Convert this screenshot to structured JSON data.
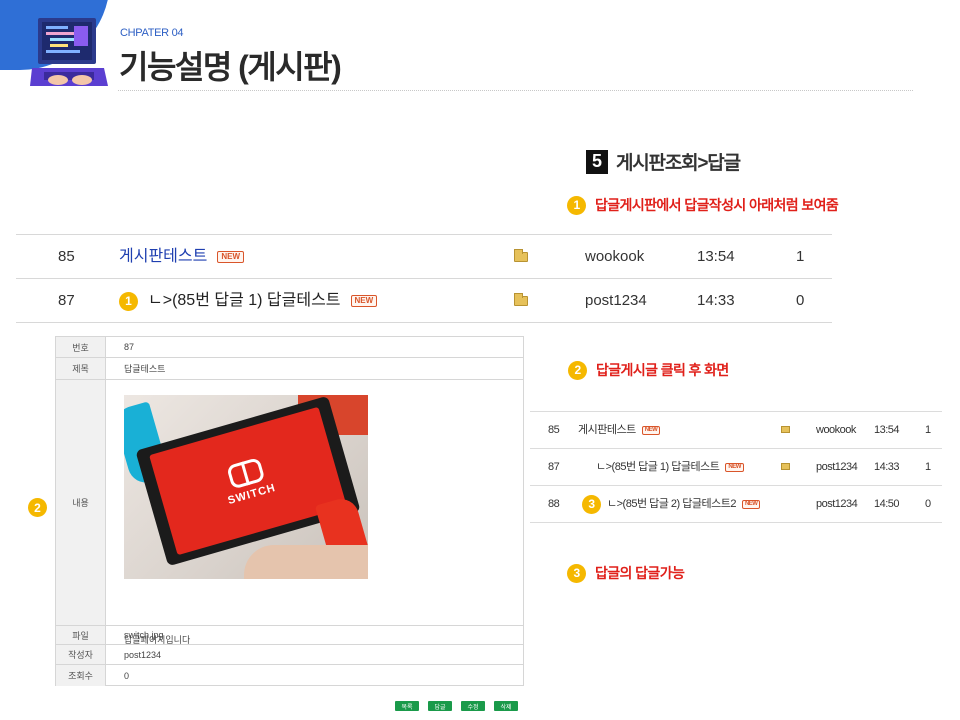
{
  "header": {
    "chapter": "CHPATER 04",
    "title": "기능설명 (게시판)"
  },
  "section": {
    "number": "5",
    "title": "게시판조회>답글"
  },
  "notes": [
    {
      "num": "1",
      "text": "답글게시판에서 답글작성시 아래처럼 보여줌"
    },
    {
      "num": "2",
      "text": "답글게시글 클릭 후 화면"
    },
    {
      "num": "3",
      "text": "답글의 답글가능"
    }
  ],
  "big_list": {
    "new_tag": "NEW",
    "rows": [
      {
        "no": "85",
        "title": "게시판테스트",
        "writer": "wookook",
        "time": "13:54",
        "hits": "1"
      },
      {
        "no": "87",
        "badge": "1",
        "title": "ㄴ>(85번 답글 1) 답글테스트",
        "writer": "post1234",
        "time": "14:33",
        "hits": "0"
      }
    ]
  },
  "detail": {
    "side_badge": "2",
    "labels": {
      "no": "번호",
      "subject": "제목",
      "content": "내용",
      "file": "파일",
      "writer": "작성자",
      "views": "조회수"
    },
    "values": {
      "no": "87",
      "subject": "답글테스트",
      "content_text": "답글페이지입니다",
      "file": "switch.jpg",
      "writer": "post1234",
      "views": "0"
    },
    "image_brand": "SWITCH",
    "buttons": [
      "목록",
      "답글",
      "수정",
      "삭제"
    ]
  },
  "small_list": {
    "new_tag": "NEW",
    "rows": [
      {
        "no": "85",
        "title": "게시판테스트",
        "writer": "wookook",
        "time": "13:54",
        "hits": "1"
      },
      {
        "no": "87",
        "title": "ㄴ>(85번 답글 1) 답글테스트",
        "writer": "post1234",
        "time": "14:33",
        "hits": "1"
      },
      {
        "no": "88",
        "badge": "3",
        "title": "ㄴ>(85번 답글 2) 답글테스트2",
        "writer": "post1234",
        "time": "14:50",
        "hits": "0"
      }
    ]
  },
  "colors": {
    "accent_blue": "#2f6fd6",
    "note_red": "#e0201a",
    "badge_yellow": "#f5b800",
    "button_green": "#1a9a4a"
  }
}
